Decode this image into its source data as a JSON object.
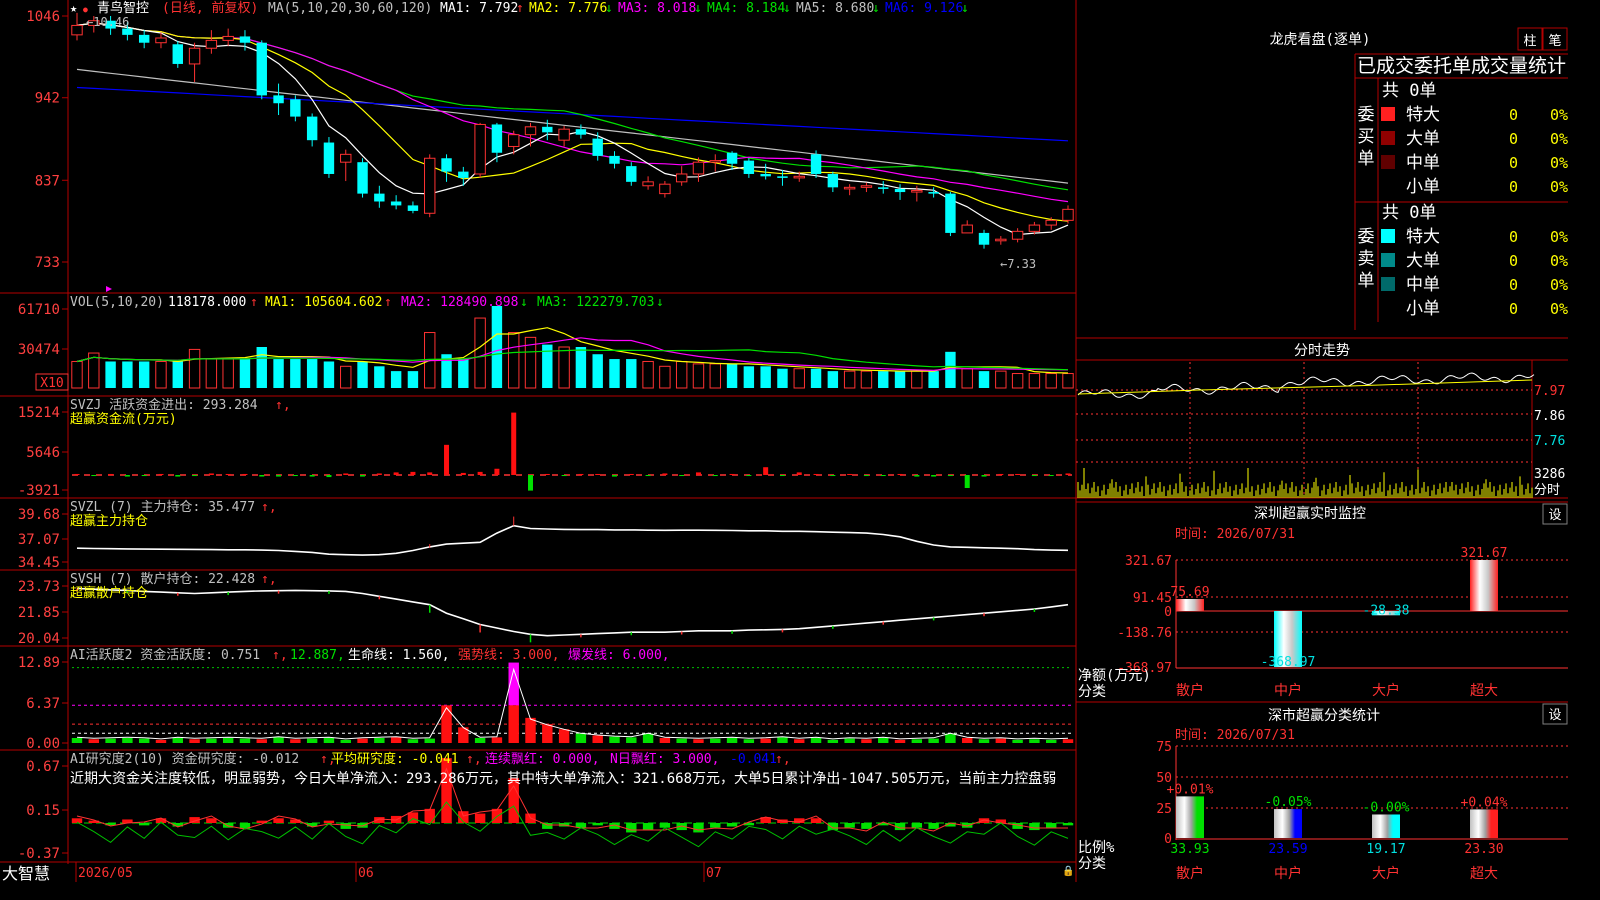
{
  "stock": {
    "name": "青鸟智控",
    "period": "(日线, 前复权)",
    "star": "★"
  },
  "colors": {
    "up": "#ff3232",
    "down": "#00ffff",
    "bg": "#000000",
    "grid": "#b40000",
    "ma1": "#ffffff",
    "ma2": "#ffff00",
    "ma3": "#ff00ff",
    "ma4": "#00e000",
    "ma5": "#c0c0c0",
    "ma6": "#0000ff"
  },
  "ma_legend": {
    "prefix": "MA(5,10,20,30,60,120)",
    "items": [
      {
        "label": "MA1:",
        "value": "7.792",
        "arrow": "↑",
        "color": "#ffffff"
      },
      {
        "label": "MA2:",
        "value": "7.776",
        "arrow": "↓",
        "color": "#ffff00"
      },
      {
        "label": "MA3:",
        "value": "8.018",
        "arrow": "↓",
        "color": "#ff00ff"
      },
      {
        "label": "MA4:",
        "value": "8.184",
        "arrow": "↓",
        "color": "#00e000"
      },
      {
        "label": "MA5:",
        "value": "8.680",
        "arrow": "↓",
        "color": "#c0c0c0"
      },
      {
        "label": "MA6:",
        "value": "9.126",
        "arrow": "↓",
        "color": "#0000ff"
      }
    ]
  },
  "price_axis": [
    "1046",
    "942",
    "837",
    "733"
  ],
  "price_marks": {
    "high": "←10.46",
    "low": "←7.33"
  },
  "vol_panel": {
    "title": "VOL(5,10,20)",
    "value": "118178.000",
    "ma1": "MA1: 105604.602",
    "ma2": "MA2: 128490.898",
    "ma3": "MA3: 122279.703",
    "axis": [
      "61710",
      "30474"
    ],
    "unit": "X10"
  },
  "svzj_panel": {
    "title": "SVZJ  活跃资金进出: 293.284",
    "sub": "超赢资金流(万元)",
    "axis": [
      "15214",
      "5646",
      "-3921"
    ]
  },
  "svzl_panel": {
    "title": "SVZL (7) 主力持仓: 35.477",
    "sub": "超赢主力持仓",
    "axis": [
      "39.68",
      "37.07",
      "34.45"
    ]
  },
  "svsh_panel": {
    "title": "SVSH (7) 散户持仓: 22.428",
    "sub": "超赢散户持仓",
    "axis": [
      "23.73",
      "21.85",
      "20.04"
    ]
  },
  "ai_panel": {
    "title": "AI活跃度2 资金活跃度: 0.751",
    "v2": "12.887,",
    "life": "生命线: 1.560,",
    "strong": "强势线: 3.000,",
    "burst": "爆发线: 6.000,",
    "axis": [
      "12.89",
      "6.37",
      "0.00"
    ]
  },
  "ai2_panel": {
    "title": "AI研究度2(10) 资金研究度: -0.012",
    "avg": "平均研究度: -0.041",
    "red": "连续飘红: 0.000,",
    "nred": "N日飘红: 3.000,",
    "last": "-0.041",
    "axis": [
      "0.67",
      "0.15",
      "-0.37"
    ],
    "desc": "近期大资金关注度较低，明显弱势，今日大单净流入：293.286万元，其中特大单净流入：321.668万元，大单5日累计净出-1047.505万元，当前主力控盘弱"
  },
  "date_axis": {
    "brand": "大智慧",
    "labels": [
      "2026/05",
      "06",
      "07"
    ]
  },
  "chart_data": {
    "type": "candlestick",
    "title": "青鸟智控 (日线, 前复权)",
    "y_ticks": [
      10.46,
      9.42,
      8.37,
      7.33
    ],
    "high_marker": 10.46,
    "low_marker": 7.33,
    "ohlc": [
      [
        10.22,
        10.34,
        10.5,
        10.15
      ],
      [
        10.34,
        10.4,
        10.46,
        10.25
      ],
      [
        10.4,
        10.3,
        10.46,
        10.22
      ],
      [
        10.3,
        10.22,
        10.38,
        10.15
      ],
      [
        10.22,
        10.12,
        10.28,
        10.05
      ],
      [
        10.12,
        10.18,
        10.25,
        10.05
      ],
      [
        10.1,
        9.85,
        10.14,
        9.8
      ],
      [
        9.85,
        10.05,
        10.12,
        9.62
      ],
      [
        10.05,
        10.15,
        10.28,
        9.98
      ],
      [
        10.15,
        10.2,
        10.3,
        10.08
      ],
      [
        10.2,
        10.12,
        10.28,
        10.02
      ],
      [
        10.12,
        9.45,
        10.15,
        9.4
      ],
      [
        9.45,
        9.35,
        9.6,
        9.2
      ],
      [
        9.4,
        9.18,
        9.45,
        9.12
      ],
      [
        9.18,
        8.88,
        9.22,
        8.8
      ],
      [
        8.85,
        8.45,
        8.92,
        8.4
      ],
      [
        8.6,
        8.7,
        8.76,
        8.36
      ],
      [
        8.6,
        8.2,
        8.65,
        8.15
      ],
      [
        8.2,
        8.1,
        8.3,
        8.02
      ],
      [
        8.1,
        8.05,
        8.18,
        8.0
      ],
      [
        8.05,
        7.98,
        8.1,
        7.95
      ],
      [
        7.95,
        8.65,
        8.7,
        7.9
      ],
      [
        8.65,
        8.48,
        8.7,
        8.35
      ],
      [
        8.48,
        8.4,
        8.54,
        8.3
      ],
      [
        8.45,
        9.08,
        9.1,
        8.4
      ],
      [
        9.08,
        8.72,
        9.1,
        8.6
      ],
      [
        8.8,
        8.95,
        9.0,
        8.7
      ],
      [
        8.95,
        9.05,
        9.1,
        8.8
      ],
      [
        9.05,
        8.98,
        9.14,
        8.88
      ],
      [
        8.88,
        9.02,
        9.06,
        8.8
      ],
      [
        9.02,
        8.95,
        9.08,
        8.9
      ],
      [
        8.9,
        8.68,
        8.98,
        8.62
      ],
      [
        8.68,
        8.58,
        8.74,
        8.52
      ],
      [
        8.55,
        8.35,
        8.6,
        8.3
      ],
      [
        8.3,
        8.35,
        8.42,
        8.25
      ],
      [
        8.2,
        8.32,
        8.36,
        8.15
      ],
      [
        8.35,
        8.45,
        8.55,
        8.3
      ],
      [
        8.45,
        8.6,
        8.66,
        8.35
      ],
      [
        8.6,
        8.62,
        8.7,
        8.48
      ],
      [
        8.72,
        8.58,
        8.74,
        8.5
      ],
      [
        8.62,
        8.45,
        8.65,
        8.4
      ],
      [
        8.45,
        8.42,
        8.58,
        8.38
      ],
      [
        8.42,
        8.4,
        8.5,
        8.3
      ],
      [
        8.4,
        8.42,
        8.48,
        8.35
      ],
      [
        8.7,
        8.45,
        8.75,
        8.4
      ],
      [
        8.45,
        8.28,
        8.48,
        8.22
      ],
      [
        8.26,
        8.28,
        8.32,
        8.18
      ],
      [
        8.28,
        8.3,
        8.34,
        8.22
      ],
      [
        8.28,
        8.26,
        8.36,
        8.2
      ],
      [
        8.26,
        8.22,
        8.32,
        8.12
      ],
      [
        8.22,
        8.24,
        8.3,
        8.1
      ],
      [
        8.22,
        8.2,
        8.28,
        8.15
      ],
      [
        8.2,
        7.7,
        8.22,
        7.66
      ],
      [
        7.7,
        7.8,
        7.86,
        7.72
      ],
      [
        7.7,
        7.55,
        7.74,
        7.5
      ],
      [
        7.6,
        7.62,
        7.66,
        7.55
      ],
      [
        7.62,
        7.72,
        7.76,
        7.58
      ],
      [
        7.72,
        7.8,
        7.84,
        7.68
      ],
      [
        7.8,
        7.86,
        7.9,
        7.74
      ],
      [
        7.86,
        8.0,
        8.05,
        7.82
      ]
    ],
    "volume": [
      2.2,
      2.9,
      2.2,
      2.2,
      2.2,
      2.2,
      2.2,
      3.2,
      2.4,
      2.4,
      2.4,
      3.4,
      2.4,
      2.4,
      2.4,
      2.2,
      1.8,
      2.2,
      1.8,
      1.4,
      1.4,
      4.6,
      2.8,
      2.4,
      5.8,
      6.8,
      4.6,
      4.2,
      3.6,
      3.4,
      3.4,
      2.8,
      2.4,
      2.4,
      2.2,
      1.8,
      2.2,
      2.0,
      2.0,
      2.0,
      1.8,
      1.8,
      1.6,
      1.6,
      1.6,
      1.4,
      1.4,
      1.4,
      1.4,
      1.4,
      1.4,
      1.4,
      3.0,
      1.6,
      1.4,
      1.4,
      1.2,
      1.2,
      1.2,
      1.2
    ],
    "svzj": [
      0.2,
      -0.2,
      0.2,
      -0.3,
      -0.2,
      0.2,
      -0.3,
      -0.2,
      0.3,
      0.2,
      0.2,
      -0.3,
      -0.3,
      -0.2,
      -0.3,
      -0.4,
      0.3,
      -0.3,
      0.3,
      0.5,
      0.6,
      0.5,
      5.8,
      0.4,
      0.6,
      1.2,
      12.0,
      -3.0,
      0.2,
      -0.2,
      0.2,
      0.2,
      -0.3,
      0.2,
      -0.2,
      0.3,
      -0.2,
      0.5,
      -0.2,
      0.2,
      -0.2,
      1.5,
      -0.2,
      0.5,
      0.2,
      -0.2,
      0.2,
      -0.2,
      -0.2,
      0.2,
      -0.3,
      -0.3,
      -0.2,
      -2.5,
      -0.3,
      0.2,
      0.2,
      -0.2,
      -0.2,
      0.3
    ],
    "svzl": [
      35.95,
      35.92,
      35.9,
      35.88,
      35.86,
      35.84,
      35.83,
      35.82,
      35.8,
      35.78,
      35.78,
      35.75,
      35.7,
      35.6,
      35.5,
      35.3,
      35.25,
      35.2,
      35.25,
      35.4,
      35.7,
      36.1,
      36.4,
      36.5,
      36.6,
      37.6,
      38.4,
      38.1,
      38.05,
      38.0,
      37.98,
      37.98,
      37.95,
      37.95,
      37.92,
      37.9,
      37.92,
      37.92,
      37.9,
      37.88,
      37.85,
      37.85,
      37.8,
      37.8,
      37.75,
      37.7,
      37.65,
      37.6,
      37.45,
      37.2,
      36.7,
      36.3,
      36.1,
      36.05,
      36.0,
      35.95,
      35.9,
      35.8,
      35.75,
      35.72
    ],
    "svsh": [
      23.55,
      23.5,
      23.45,
      23.42,
      23.35,
      23.3,
      23.25,
      23.2,
      23.25,
      23.3,
      23.35,
      23.38,
      23.4,
      23.42,
      23.4,
      23.38,
      23.35,
      23.2,
      23.0,
      22.8,
      22.6,
      22.4,
      21.8,
      21.4,
      21.0,
      20.75,
      20.5,
      20.3,
      20.2,
      20.25,
      20.3,
      20.35,
      20.4,
      20.45,
      20.45,
      20.45,
      20.5,
      20.55,
      20.55,
      20.55,
      20.6,
      20.62,
      20.65,
      20.7,
      20.8,
      20.9,
      21.0,
      21.1,
      21.2,
      21.3,
      21.4,
      21.5,
      21.6,
      21.7,
      21.8,
      21.9,
      22.0,
      22.1,
      22.25,
      22.4
    ],
    "ai_activity": [
      0.8,
      0.6,
      0.7,
      0.8,
      0.7,
      0.5,
      0.8,
      0.6,
      0.7,
      0.8,
      0.7,
      0.6,
      0.9,
      0.6,
      0.7,
      0.8,
      0.5,
      0.7,
      0.8,
      0.9,
      0.6,
      0.7,
      6.0,
      2.5,
      0.8,
      0.9,
      12.8,
      4.0,
      3.0,
      2.2,
      1.5,
      1.2,
      1.0,
      0.9,
      1.5,
      0.8,
      0.7,
      0.6,
      0.7,
      0.8,
      0.6,
      0.7,
      0.9,
      0.6,
      0.8,
      0.5,
      0.7,
      0.6,
      0.8,
      0.5,
      0.6,
      0.7,
      1.5,
      0.8,
      0.6,
      0.7,
      0.5,
      0.6,
      0.5,
      0.6
    ],
    "ai_research": [
      0.04,
      0.02,
      -0.02,
      0.03,
      -0.02,
      0.04,
      -0.03,
      0.05,
      0.04,
      -0.04,
      -0.05,
      0.02,
      0.04,
      0.03,
      -0.03,
      0.02,
      -0.05,
      -0.04,
      0.05,
      0.06,
      0.09,
      0.12,
      0.55,
      0.1,
      0.08,
      0.12,
      0.38,
      0.08,
      -0.05,
      -0.03,
      -0.04,
      -0.02,
      -0.05,
      -0.08,
      -0.06,
      -0.04,
      -0.06,
      -0.08,
      -0.04,
      -0.03,
      -0.02,
      0.05,
      0.03,
      0.04,
      0.04,
      -0.06,
      -0.04,
      -0.05,
      -0.02,
      -0.06,
      -0.04,
      -0.05,
      -0.03,
      -0.04,
      0.04,
      0.03,
      -0.05,
      -0.06,
      -0.04,
      -0.02
    ],
    "dates": [
      "2026/05",
      "06",
      "07"
    ]
  },
  "right": {
    "tabs": [
      "柱",
      "笔"
    ],
    "dragon_title": "龙虎看盘(逐单)",
    "order_header": "已成交委托单成交量统计",
    "buy": {
      "label": "委买单",
      "total": "共 0单",
      "rows": [
        {
          "name": "特大",
          "n": "0",
          "p": "0%",
          "c": "#ff2020"
        },
        {
          "name": "大单",
          "n": "0",
          "p": "0%",
          "c": "#900000"
        },
        {
          "name": "中单",
          "n": "0",
          "p": "0%",
          "c": "#600000"
        },
        {
          "name": "小单",
          "n": "0",
          "p": "0%",
          "c": "#000000"
        }
      ]
    },
    "sell": {
      "label": "委卖单",
      "total": "共 0单",
      "rows": [
        {
          "name": "特大",
          "n": "0",
          "p": "0%",
          "c": "#00ffff"
        },
        {
          "name": "大单",
          "n": "0",
          "p": "0%",
          "c": "#008a8a"
        },
        {
          "name": "中单",
          "n": "0",
          "p": "0%",
          "c": "#006a6a"
        },
        {
          "name": "小单",
          "n": "0",
          "p": "0%",
          "c": "#000000"
        }
      ]
    },
    "fenshi": {
      "title": "分时走势",
      "axis": [
        "7.97",
        "7.86",
        "7.76",
        "3286"
      ],
      "unit": "分时"
    },
    "sz_monitor": {
      "title": "深圳超赢实时监控",
      "set": "设",
      "time": "时间: 2026/07/31",
      "axis": [
        "321.67",
        "91.45",
        "0",
        "-138.76",
        "-368.97"
      ],
      "ylabel": "净额(万元)",
      "xlabel": "分类",
      "cats": [
        "散户",
        "中户",
        "大户",
        "超大"
      ],
      "values": [
        75.69,
        -368.97,
        -28.38,
        321.67
      ],
      "labels": [
        "75.69",
        "-368.97",
        "-28.38",
        "321.67"
      ]
    },
    "sz_stats": {
      "title": "深市超赢分类统计",
      "set": "设",
      "time": "时间: 2026/07/31",
      "axis": [
        "75",
        "50",
        "25",
        "0"
      ],
      "ylabel": "比例%",
      "xlabel": "分类",
      "cats": [
        "散户",
        "中户",
        "大户",
        "超大"
      ],
      "values": [
        33.93,
        23.59,
        19.17,
        23.3
      ],
      "labels": [
        "33.93",
        "23.59",
        "19.17",
        "23.30"
      ],
      "deltas": [
        "+0.01%",
        "-0.05%",
        "-0.00%",
        "+0.04%"
      ]
    }
  }
}
